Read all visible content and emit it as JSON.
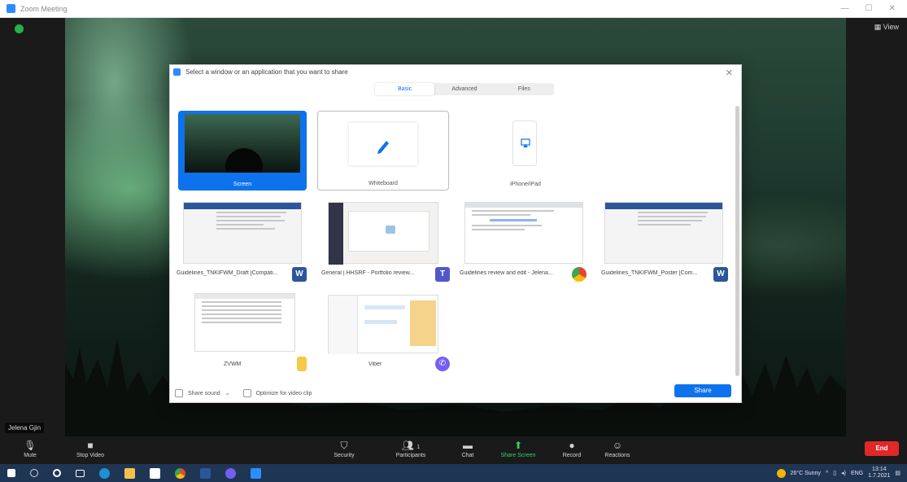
{
  "window": {
    "title": "Zoom Meeting",
    "view_label": "View"
  },
  "participant": {
    "name": "Jelena Gjin"
  },
  "dialog": {
    "title": "Select a window or an application that you want to share",
    "tabs": [
      {
        "label": "Basic"
      },
      {
        "label": "Advanced"
      },
      {
        "label": "Files"
      }
    ],
    "active_tab": "Basic",
    "tiles": [
      {
        "label": "Screen"
      },
      {
        "label": "Whiteboard"
      },
      {
        "label": "iPhone/iPad"
      }
    ],
    "windows": [
      {
        "label": "Guidelines_TNKIFWM_Draft [Compati...",
        "app": "Word"
      },
      {
        "label": "General | HHSRF - Portfolio review...",
        "app": "Teams"
      },
      {
        "label": "Guidelines review and edit - Jelena...",
        "app": "Chrome"
      },
      {
        "label": "Guidelines_TNKIFWM_Poster [Com...",
        "app": "Word"
      },
      {
        "label": "ZVWM",
        "app": "Folder"
      },
      {
        "label": "Viber",
        "app": "Viber"
      }
    ],
    "footer": {
      "share_sound": "Share sound",
      "optimize": "Optimize for video clip",
      "share_button": "Share"
    }
  },
  "toolbar": {
    "items": [
      {
        "label": "Mute",
        "icon": "mic-icon"
      },
      {
        "label": "Stop Video",
        "icon": "camera-icon"
      },
      {
        "label": "Security",
        "icon": "shield-icon"
      },
      {
        "label": "Participants",
        "icon": "people-icon",
        "count": "1"
      },
      {
        "label": "Chat",
        "icon": "chat-icon"
      },
      {
        "label": "Share Screen",
        "icon": "share-screen-icon"
      },
      {
        "label": "Record",
        "icon": "record-icon"
      },
      {
        "label": "Reactions",
        "icon": "smile-icon"
      }
    ],
    "end_label": "End"
  },
  "taskbar": {
    "weather": "26°C Sunny",
    "language": "ENG",
    "time": "13:14",
    "date": "1.7.2021"
  },
  "colors": {
    "accent": "#0e72ed",
    "end": "#e02828",
    "share_active": "#2fd36a",
    "arrow": "#e01b1b"
  }
}
